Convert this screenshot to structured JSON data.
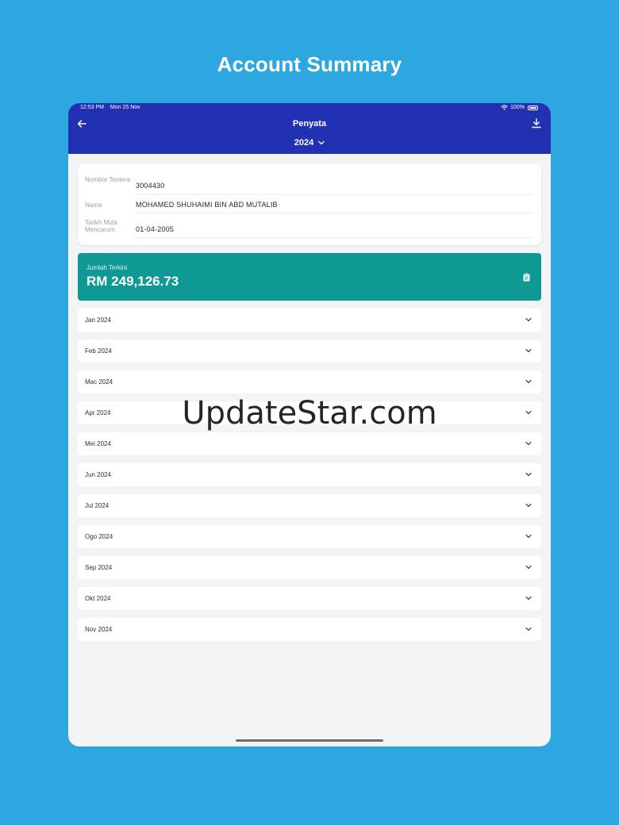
{
  "promo": {
    "title": "Account Summary"
  },
  "status_bar": {
    "time": "12:53 PM",
    "date": "Mon 25 Nov",
    "battery": "100%"
  },
  "header": {
    "title": "Penyata",
    "year": "2024"
  },
  "info": {
    "rows": [
      {
        "label": "Nombor Tentera",
        "value": "3004430"
      },
      {
        "label": "Nama",
        "value": "MOHAMED SHUHAIMI BIN ABD MUTALIB"
      },
      {
        "label": "Tarikh Mula Mencarum",
        "value": "01-04-2005"
      }
    ]
  },
  "total": {
    "label": "Jumlah Terkini",
    "value": "RM 249,126.73"
  },
  "months": [
    {
      "label": "Jan 2024"
    },
    {
      "label": "Feb 2024"
    },
    {
      "label": "Mac 2024"
    },
    {
      "label": "Apr 2024"
    },
    {
      "label": "Mei 2024"
    },
    {
      "label": "Jun 2024"
    },
    {
      "label": "Jul 2024"
    },
    {
      "label": "Ogo 2024"
    },
    {
      "label": "Sep 2024"
    },
    {
      "label": "Okt 2024"
    },
    {
      "label": "Nov 2024"
    }
  ],
  "watermark": "UpdateStar.com",
  "colors": {
    "background": "#2ea7e0",
    "header": "#2230b2",
    "accent": "#0f9994"
  }
}
